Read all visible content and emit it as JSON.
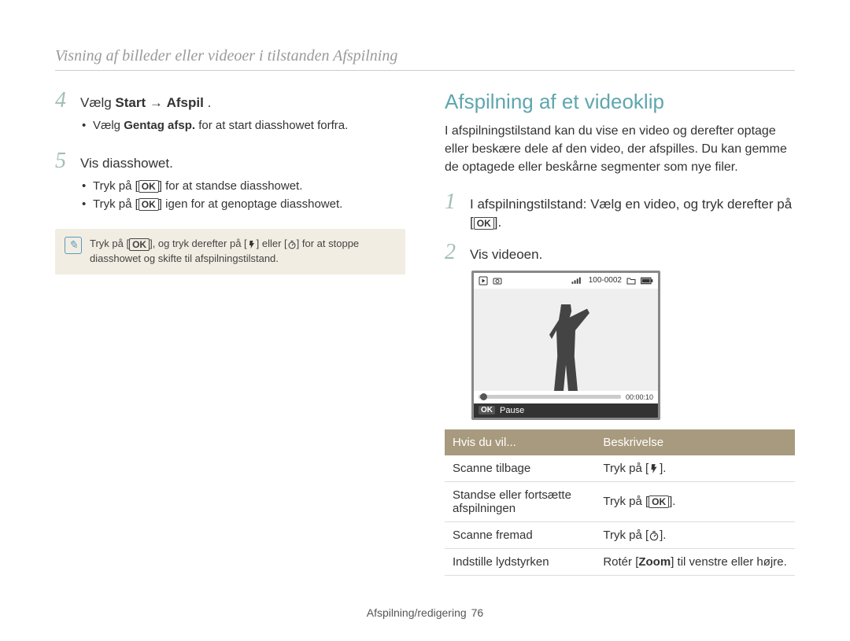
{
  "breadcrumb": "Visning af billeder eller videoer i tilstanden Afspilning",
  "left": {
    "step4": {
      "num": "4",
      "prefix": "Vælg ",
      "bold1": "Start",
      "arrow": " → ",
      "bold2": "Afspil",
      "suffix": " ."
    },
    "step4_bullet": {
      "prefix": "Vælg ",
      "bold": "Gentag afsp.",
      "rest": " for at start diasshowet forfra."
    },
    "step5": {
      "num": "5",
      "text": "Vis diasshowet."
    },
    "step5_bullets": {
      "b1_pre": "Tryk på [",
      "b1_post": "] for at standse diasshowet.",
      "b2_pre": "Tryk på [",
      "b2_post": "] igen for at genoptage diasshowet."
    },
    "note": {
      "pre": "Tryk på [",
      "mid1": "], og tryk derefter på [",
      "mid2": "] eller [",
      "post": "] for at stoppe diasshowet og skifte til afspilningstilstand."
    }
  },
  "right": {
    "title": "Afspilning af et videoklip",
    "intro": "I afspilningstilstand kan du vise en video og derefter optage eller beskære dele af den video, der afspilles. Du kan gemme de optagede eller beskårne segmenter som nye filer.",
    "step1": {
      "num": "1",
      "line1": "I afspilningstilstand: Vælg en video, og tryk derefter på",
      "line2_pre": "[",
      "line2_post": "]."
    },
    "step2": {
      "num": "2",
      "text": "Vis videoen."
    },
    "video_frame": {
      "counter": "100-0002",
      "time": "00:00:10",
      "pause_label": "Pause",
      "ok": "OK"
    },
    "table": {
      "col1": "Hvis du vil...",
      "col2": "Beskrivelse",
      "rows": [
        {
          "action": "Scanne tilbage",
          "desc_pre": "Tryk på [",
          "icon": "flash",
          "desc_post": "]."
        },
        {
          "action": "Standse eller fortsætte afspilningen",
          "desc_pre": "Tryk på [",
          "icon": "ok",
          "desc_post": "]."
        },
        {
          "action": "Scanne fremad",
          "desc_pre": "Tryk på [",
          "icon": "timer",
          "desc_post": "]."
        },
        {
          "action": "Indstille lydstyrken",
          "desc_plain_pre": "Rotér [",
          "desc_bold": "Zoom",
          "desc_plain_post": "] til venstre eller højre."
        }
      ]
    }
  },
  "footer": {
    "section": "Afspilning/redigering",
    "page": "76"
  },
  "glyphs": {
    "ok": "OK"
  }
}
